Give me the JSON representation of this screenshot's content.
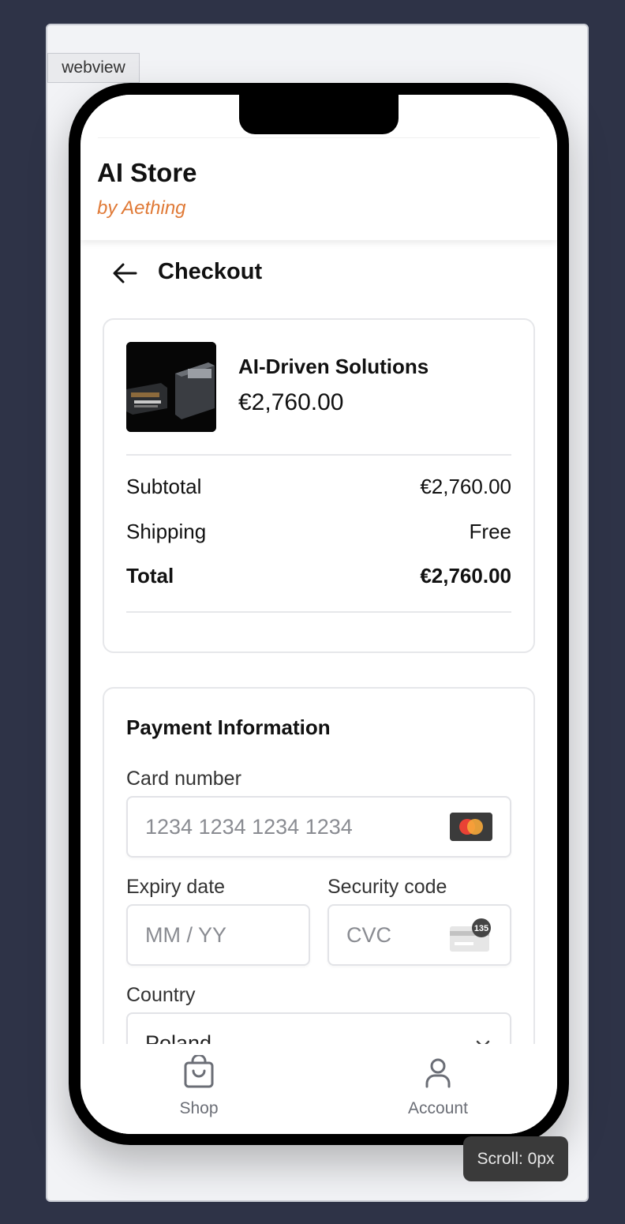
{
  "webview_label": "webview",
  "header": {
    "title": "AI Store",
    "subtitle": "by Aething"
  },
  "checkout": {
    "title": "Checkout"
  },
  "order": {
    "product_name": "AI-Driven Solutions",
    "product_price": "€2,760.00",
    "summary": [
      {
        "label": "Subtotal",
        "value": "€2,760.00"
      },
      {
        "label": "Shipping",
        "value": "Free"
      },
      {
        "label": "Total",
        "value": "€2,760.00"
      }
    ]
  },
  "payment": {
    "title": "Payment Information",
    "card_number_label": "Card number",
    "card_number_placeholder": "1234 1234 1234 1234",
    "expiry_label": "Expiry date",
    "expiry_placeholder": "MM / YY",
    "security_label": "Security code",
    "security_placeholder": "CVC",
    "cvc_icon_text": "135",
    "country_label": "Country",
    "country_value": "Poland"
  },
  "tabs": [
    {
      "label": "Shop",
      "icon": "shopping-bag-icon"
    },
    {
      "label": "Account",
      "icon": "user-icon"
    }
  ],
  "scroll_indicator": "Scroll: 0px",
  "colors": {
    "accent": "#e07a37",
    "background": "#2e3347"
  }
}
